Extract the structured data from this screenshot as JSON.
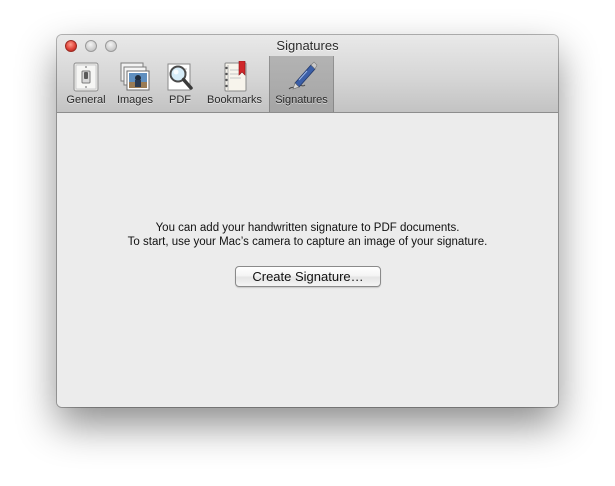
{
  "window": {
    "title": "Signatures"
  },
  "toolbar": {
    "items": [
      {
        "label": "General",
        "icon": "light-switch-icon"
      },
      {
        "label": "Images",
        "icon": "photo-stack-icon"
      },
      {
        "label": "PDF",
        "icon": "magnifier-pdf-icon"
      },
      {
        "label": "Bookmarks",
        "icon": "bookmark-book-icon"
      },
      {
        "label": "Signatures",
        "icon": "fountain-pen-icon"
      }
    ],
    "selected": "Signatures"
  },
  "content": {
    "message_line1": "You can add your handwritten signature to PDF documents.",
    "message_line2": "To start, use your Mac’s camera to capture an image of your signature.",
    "create_button": "Create Signature…"
  },
  "colors": {
    "close_button": "#e0443a",
    "selected_tab": "#acacac",
    "content_background": "#ececec"
  }
}
